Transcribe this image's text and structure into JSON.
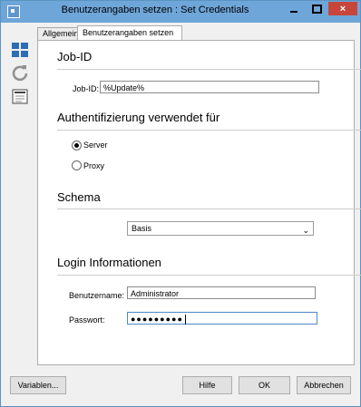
{
  "window": {
    "title": "Benutzerangaben setzen : Set Credentials",
    "controls": {
      "minimize_icon": "minimize-icon",
      "maximize_icon": "maximize-icon",
      "close_icon": "close-icon"
    }
  },
  "sidebar": {
    "items": [
      {
        "icon": "layout-grid-icon"
      },
      {
        "icon": "refresh-icon"
      },
      {
        "icon": "document-icon"
      }
    ]
  },
  "tabs": [
    {
      "label": "Allgemein",
      "active": false
    },
    {
      "label": "Benutzerangaben setzen",
      "active": true
    }
  ],
  "job": {
    "section_title": "Job-ID",
    "label": "Job-ID:",
    "value": "%Update%"
  },
  "auth": {
    "section_title": "Authentifizierung verwendet für",
    "options": [
      {
        "label": "Server",
        "checked": true
      },
      {
        "label": "Proxy",
        "checked": false
      }
    ]
  },
  "schema": {
    "section_title": "Schema",
    "selected": "Basis",
    "chevron": "chevron-down-icon"
  },
  "login": {
    "section_title": "Login Informationen",
    "username_label": "Benutzername:",
    "username_value": "Administrator",
    "password_label": "Passwort:",
    "password_value": "●●●●●●●●●"
  },
  "footer": {
    "variables": "Variablen...",
    "help": "Hilfe",
    "ok": "OK",
    "cancel": "Abbrechen"
  }
}
